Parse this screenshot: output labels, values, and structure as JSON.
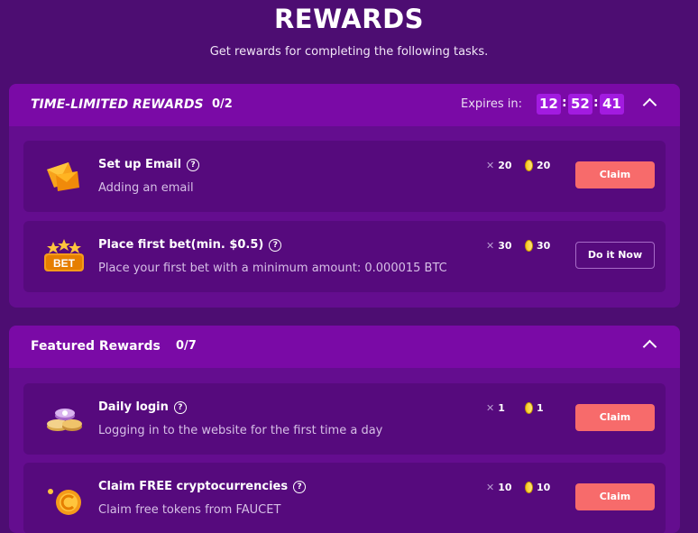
{
  "page": {
    "title": "REWARDS",
    "subtitle": "Get rewards for completing the following tasks."
  },
  "time_limited": {
    "title": "TIME-LIMITED REWARDS",
    "count": "0/2",
    "expires_label": "Expires in:",
    "timer": {
      "hours": "12",
      "minutes": "52",
      "seconds": "41"
    },
    "tasks": [
      {
        "title": "Set up Email",
        "description": "Adding an email",
        "xp": "20",
        "coins": "20",
        "action": "Claim",
        "icon": "envelope-icon"
      },
      {
        "title": "Place first bet(min. $0.5)",
        "description": "Place your first bet with a minimum amount: 0.000015 BTC",
        "xp": "30",
        "coins": "30",
        "action": "Do it Now",
        "icon": "bet-badge-icon"
      }
    ]
  },
  "featured": {
    "title": "Featured Rewards",
    "count": "0/7",
    "tasks": [
      {
        "title": "Daily login",
        "description": "Logging in to the website for the first time a day",
        "xp": "1",
        "coins": "1",
        "action": "Claim",
        "icon": "casino-chips-icon"
      },
      {
        "title": "Claim FREE cryptocurrencies",
        "description": "Claim free tokens from FAUCET",
        "xp": "10",
        "coins": "10",
        "action": "Claim",
        "icon": "faucet-coin-icon"
      }
    ]
  },
  "colors": {
    "background": "#4d0d72",
    "panel": "#640d8f",
    "panel_header": "#7a0aa6",
    "task_card": "#560a7d",
    "timer_box": "#a21be0",
    "claim_button": "#f76b6b"
  }
}
